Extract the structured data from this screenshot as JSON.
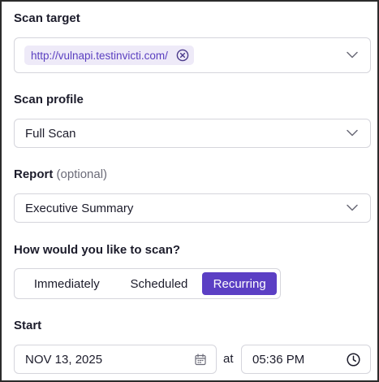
{
  "scan_target": {
    "label": "Scan target",
    "chip_text": "http://vulnapi.testinvicti.com/"
  },
  "scan_profile": {
    "label": "Scan profile",
    "value": "Full Scan"
  },
  "report": {
    "label": "Report",
    "optional": "(optional)",
    "value": "Executive Summary"
  },
  "scan_mode": {
    "label": "How would you like to scan?",
    "options": [
      "Immediately",
      "Scheduled",
      "Recurring"
    ],
    "selected": "Recurring"
  },
  "start": {
    "label": "Start",
    "date": "NOV 13, 2025",
    "at": "at",
    "time": "05:36 PM"
  },
  "colors": {
    "accent": "#5b3fc4",
    "chip_bg": "#eeeaf8",
    "chip_text": "#5a3fc0",
    "border": "#d5d5dc"
  },
  "icons": [
    "close-circle-icon",
    "chevron-down-icon",
    "calendar-icon",
    "clock-icon"
  ]
}
